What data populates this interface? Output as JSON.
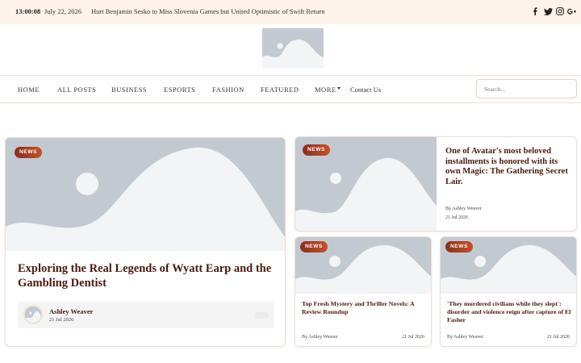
{
  "topbar": {
    "time": "13:00:08",
    "date": "July 22, 2026",
    "headline": "Hurt Benjamin Sesko to Miss Slovenia Games but United Optimistic of Swift Return",
    "social_icons": [
      "facebook-icon",
      "twitter-icon",
      "instagram-icon",
      "google-plus-icon"
    ]
  },
  "logo": {
    "icon": "image-placeholder-icon"
  },
  "nav": {
    "items": [
      "Home",
      "All Posts",
      "Business",
      "Esports",
      "Fashion",
      "Featured",
      "More"
    ],
    "contact": "Contact Us",
    "search_placeholder": "Search..."
  },
  "featured": {
    "badge": "NEWS",
    "title": "Exploring the Real Legends of Wyatt Earp and the Gambling Dentist",
    "author": "Ashley Weaver",
    "date": "21 Jul 2026"
  },
  "side_post": {
    "badge": "NEWS",
    "title": "One of Avatar's most beloved installments is honored with its own Magic: The Gathering Secret Lair.",
    "author_line": "By Ashley Weaver",
    "date": "21 Jul 2026"
  },
  "small_posts": [
    {
      "badge": "NEWS",
      "title": "Top Fresh Mystery and Thriller Novels: A Review Roundup",
      "author_line": "By Ashley Weaver",
      "date": "21 Jul 2026"
    },
    {
      "badge": "NEWS",
      "title": "'They murdered civilians while they slept': disorder and violence reign after capture of El Fasher",
      "author_line": "By Ashley Weaver",
      "date": "21 Jul 2026"
    }
  ],
  "colors": {
    "topbar_bg": "#fdf3ea",
    "accent": "#c4512c",
    "title": "#4a1a0e",
    "placeholder": "#c3c9d0"
  }
}
